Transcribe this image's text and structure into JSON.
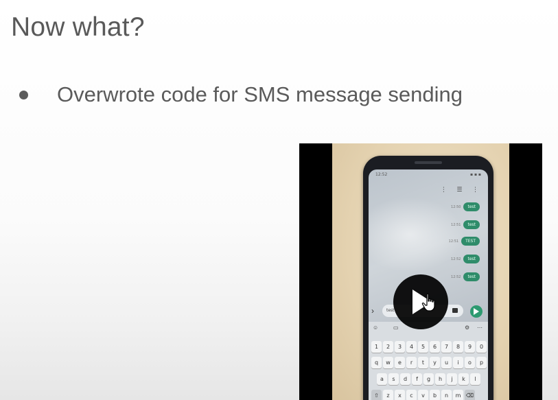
{
  "slide": {
    "title": "Now what?",
    "bullets": [
      {
        "text": "Overwrote code for SMS message sending"
      }
    ]
  },
  "video": {
    "phone": {
      "status_time": "12:52",
      "status_icons": "▪ ▪ ▪",
      "toolbar_icons": "⋮ ☰ ⋮",
      "messages": [
        {
          "time": "12:50",
          "text": "test"
        },
        {
          "time": "12:51",
          "text": "test"
        },
        {
          "time": "12:51",
          "text": "TEST"
        },
        {
          "time": "12:52",
          "text": "test"
        },
        {
          "time": "12:52",
          "text": "test"
        }
      ],
      "compose_text": "test",
      "keyboard_tools": {
        "left": "☺",
        "gif": "▭",
        "gear": "⚙",
        "more": "⋯"
      },
      "keyboard_rows": [
        [
          "1",
          "2",
          "3",
          "4",
          "5",
          "6",
          "7",
          "8",
          "9",
          "0"
        ],
        [
          "q",
          "w",
          "e",
          "r",
          "t",
          "y",
          "u",
          "i",
          "o",
          "p"
        ],
        [
          "a",
          "s",
          "d",
          "f",
          "g",
          "h",
          "j",
          "k",
          "l"
        ],
        [
          "⇧",
          "z",
          "x",
          "c",
          "v",
          "b",
          "n",
          "m",
          "⌫"
        ]
      ]
    },
    "colors": {
      "bubble": "#2f8c6a",
      "send": "#2d9a70"
    },
    "play_icon": "play-icon",
    "cursor_icon": "hand-cursor-icon"
  }
}
